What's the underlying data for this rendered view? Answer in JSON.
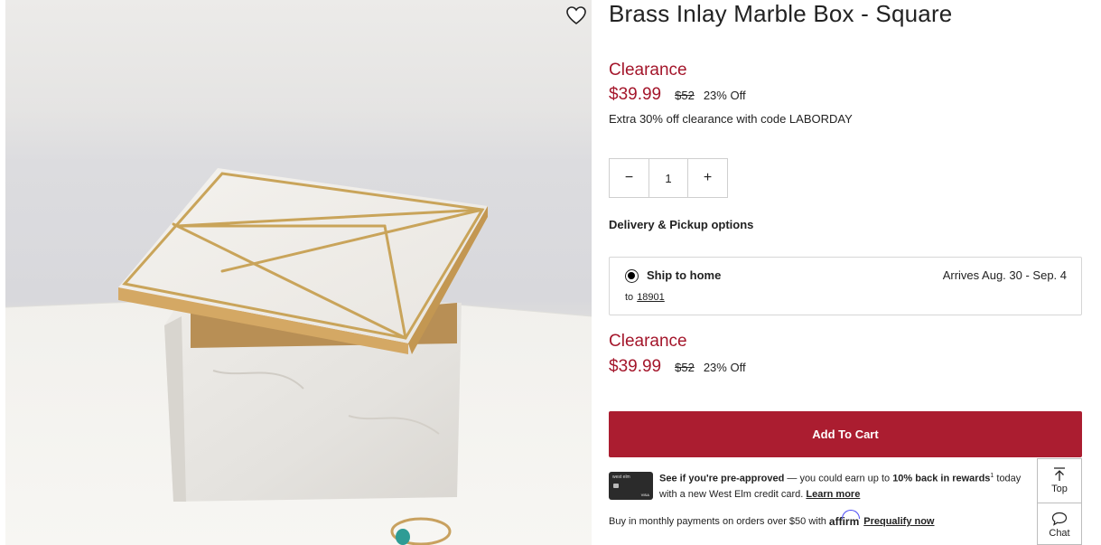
{
  "product": {
    "title": "Brass Inlay Marble Box - Square",
    "clearance_label": "Clearance",
    "price": "$39.99",
    "original_price": "$52",
    "discount": "23% Off",
    "promo": "Extra 30% off clearance with code LABORDAY",
    "quantity": "1"
  },
  "qty": {
    "decrease": "−",
    "increase": "+"
  },
  "delivery": {
    "heading": "Delivery & Pickup options",
    "option_label": "Ship to home",
    "arrival": "Arrives Aug. 30 - Sep. 4",
    "to_label": "to",
    "zip": "18901"
  },
  "summary": {
    "clearance_label": "Clearance",
    "price": "$39.99",
    "original_price": "$52",
    "discount": "23% Off"
  },
  "cart": {
    "add_label": "Add To Cart"
  },
  "credit": {
    "card_brand": "west elm",
    "card_network": "VISA",
    "preapproved": "See if you're pre-approved",
    "earn_text": " — you could earn up to ",
    "percent": "10% back in rewards",
    "sup": "1",
    "tail": " today with a new West Elm credit card. ",
    "learn_more": "Learn more"
  },
  "financing": {
    "text": "Buy in monthly payments on orders over $50 with",
    "brand": "affirm",
    "link": "Prequalify now"
  },
  "side": {
    "top_label": "Top",
    "chat_label": "Chat"
  },
  "colors": {
    "accent": "#ab1d30",
    "price": "#a4162b",
    "brass": "#c9a45a"
  }
}
